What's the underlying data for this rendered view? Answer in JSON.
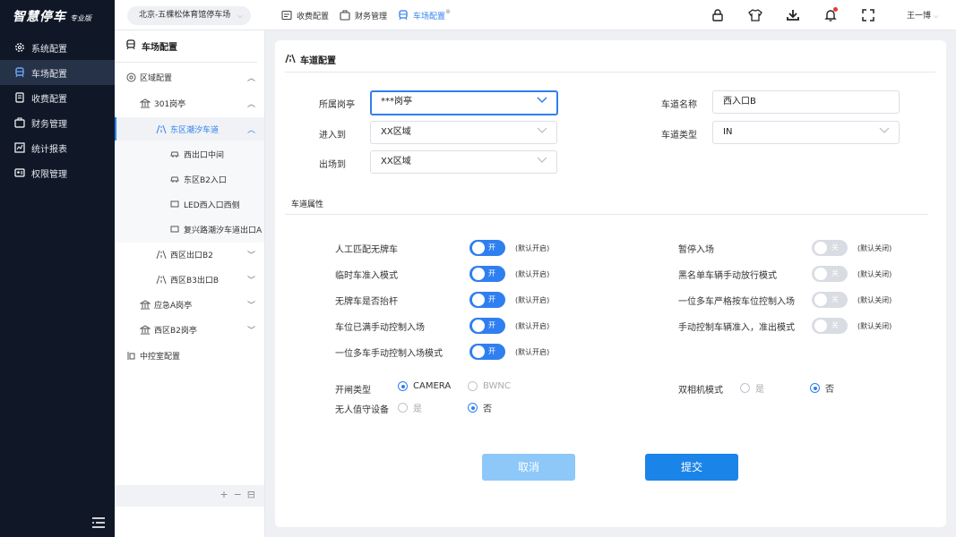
{
  "brand": {
    "name": "智慧停车",
    "edition": "专业版"
  },
  "nav": {
    "items": [
      {
        "label": "系统配置",
        "icon": "gear-icon"
      },
      {
        "label": "车场配置",
        "icon": "parking-icon",
        "active": true
      },
      {
        "label": "收费配置",
        "icon": "invoice-icon"
      },
      {
        "label": "财务管理",
        "icon": "finance-icon"
      },
      {
        "label": "统计报表",
        "icon": "chart-icon"
      },
      {
        "label": "权限管理",
        "icon": "permission-icon"
      }
    ]
  },
  "topbar": {
    "lot": "北京-五棵松体育馆停车场",
    "tabs": [
      {
        "label": "收费配置"
      },
      {
        "label": "财务管理"
      },
      {
        "label": "车场配置",
        "active": true
      }
    ],
    "user": "王一博"
  },
  "tree": {
    "title": "车场配置",
    "nodes": {
      "area_config": "区域配置",
      "booth_301": "301岗亭",
      "lane_east": "东区潮汐车道",
      "exit_mid": "西出口中间",
      "east_b2_entry": "东区B2入口",
      "led_west": "LED西入口西侧",
      "fuxing": "复兴路潮汐车道出口A",
      "west_b2": "西区出口B2",
      "west_b3": "西区B3出口B",
      "emergency_a": "应急A岗亭",
      "west_b2_booth": "西区B2岗亭",
      "control_room": "中控室配置"
    }
  },
  "form": {
    "title": "车道配置",
    "booth_label": "所属岗亭",
    "booth_value": "***岗亭",
    "enter_label": "进入到",
    "enter_value": "XX区域",
    "exit_label": "出场到",
    "exit_value": "XX区域",
    "lane_name_label": "车道名称",
    "lane_name_value": "西入口B",
    "lane_type_label": "车道类型",
    "lane_type_value": "IN"
  },
  "props": {
    "title": "车道属性",
    "on_text": "开",
    "off_text": "关",
    "left": [
      {
        "label": "人工匹配无牌车",
        "hint": "(默认开启)"
      },
      {
        "label": "临时车准入模式",
        "hint": "(默认开启)"
      },
      {
        "label": "无牌车是否抬杆",
        "hint": "(默认开启)"
      },
      {
        "label": "车位已满手动控制入场",
        "hint": "(默认开启)"
      },
      {
        "label": "一位多车手动控制入场模式",
        "hint": "(默认开启)"
      }
    ],
    "right": [
      {
        "label": "暂停入场",
        "hint": "(默认关闭)"
      },
      {
        "label": "黑名单车辆手动放行模式",
        "hint": "(默认关闭)"
      },
      {
        "label": "一位多车严格按车位控制入场",
        "hint": "(默认关闭)"
      },
      {
        "label": "手动控制车辆准入，准出模式",
        "hint": "(默认关闭)"
      }
    ],
    "gate_type_label": "开闸类型",
    "gate_opt1": "CAMERA",
    "gate_opt2": "BWNC",
    "dual_cam_label": "双相机模式",
    "yes": "是",
    "no": "否",
    "unattended_label": "无人值守设备"
  },
  "buttons": {
    "cancel": "取消",
    "submit": "提交"
  },
  "colors": {
    "primary": "#2f7ff0",
    "nav_bg": "#101828"
  }
}
